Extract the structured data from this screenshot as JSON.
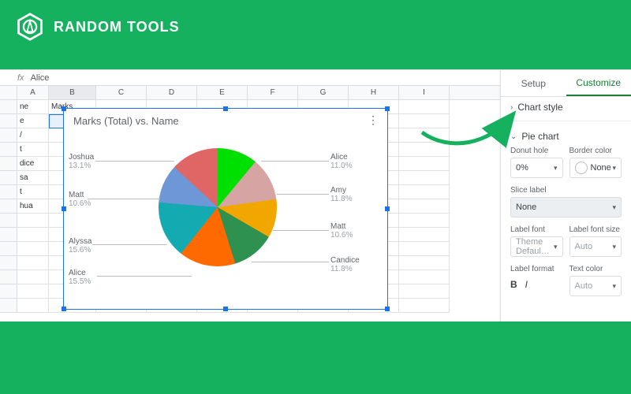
{
  "brand": {
    "name": "RANDOM TOOLS"
  },
  "formula_bar": {
    "fx": "fx",
    "value": "Alice"
  },
  "columns": [
    "A",
    "B",
    "C",
    "D",
    "E",
    "F",
    "G",
    "H",
    "I"
  ],
  "header_row": {
    "A": "ne",
    "B": "Marks"
  },
  "rows": [
    {
      "A": "e"
    },
    {
      "A": "/"
    },
    {
      "A": "t"
    },
    {
      "A": "dice"
    },
    {
      "A": "sa"
    },
    {
      "A": "t"
    },
    {
      "A": "hua"
    }
  ],
  "chart": {
    "title": "Marks (Total) vs. Name",
    "labels": {
      "alice": {
        "name": "Alice",
        "pct": "11.0%"
      },
      "amy": {
        "name": "Amy",
        "pct": "11.8%"
      },
      "matt2": {
        "name": "Matt",
        "pct": "10.6%"
      },
      "candice": {
        "name": "Candice",
        "pct": "11.8%"
      },
      "alice2": {
        "name": "Alice",
        "pct": "15.5%"
      },
      "alyssa": {
        "name": "Alyssa",
        "pct": "15.6%"
      },
      "matt1": {
        "name": "Matt",
        "pct": "10.6%"
      },
      "joshua": {
        "name": "Joshua",
        "pct": "13.1%"
      }
    }
  },
  "panel": {
    "tabs": {
      "setup": "Setup",
      "customize": "Customize"
    },
    "prev_section": "Chart style",
    "section": "Pie chart",
    "donut_hole": {
      "label": "Donut hole",
      "value": "0%"
    },
    "border_color": {
      "label": "Border color",
      "value": "None"
    },
    "slice_label": {
      "label": "Slice label",
      "value": "None"
    },
    "label_font": {
      "label": "Label font",
      "value": "Theme Defaul…"
    },
    "label_size": {
      "label": "Label font size",
      "value": "Auto"
    },
    "label_format": {
      "label": "Label format"
    },
    "text_color": {
      "label": "Text color",
      "value": "Auto"
    }
  },
  "chart_data": {
    "type": "pie",
    "title": "Marks (Total) vs. Name",
    "categories": [
      "Alice",
      "Amy",
      "Matt",
      "Candice",
      "Alice",
      "Alyssa",
      "Matt",
      "Joshua"
    ],
    "values": [
      11.0,
      11.8,
      10.6,
      11.8,
      15.5,
      15.6,
      10.6,
      13.1
    ],
    "unit": "percent",
    "colors": [
      "#00e000",
      "#d7a4a4",
      "#f2a600",
      "#2f914f",
      "#ff6a00",
      "#13aab2",
      "#6d97d6",
      "#e06666"
    ]
  }
}
